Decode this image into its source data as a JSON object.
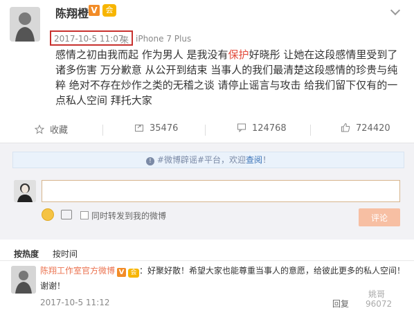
{
  "post": {
    "author": "陈翔橙",
    "badge_v": "V",
    "badge_member": "会",
    "date": "2017-10-5 11:07",
    "source_prefix": "来",
    "device": "iPhone 7 Plus",
    "content_parts": [
      "感情之初由我而起 作为男人 是我没有",
      "保护",
      "好晓彤 让她在这段感情里受到了诸多伤害 万分歉意 从公开到结束 当事人的我们最清楚这段感情的珍贵与纯粹 绝对不存在炒作之类的无稽之谈 请停止谣言与攻击 给我们留下仅有的一点私人空间 拜托大家"
    ]
  },
  "actions": {
    "favorite": "收藏",
    "share_count": "35476",
    "comment_count": "124768",
    "like_count": "724420"
  },
  "comment_box": {
    "notice_prefix": "#微博辟谣#平台，欢迎",
    "notice_link": "查阅",
    "notice_suffix": "！",
    "input_value": "",
    "also_forward_label": "同时转发到我的微博",
    "submit_label": "评论"
  },
  "sort_tabs": {
    "hot": "按热度",
    "time": "按时间"
  },
  "comment": {
    "author": "陈翔工作室官方微博",
    "badge_v": "V",
    "badge_member": "会",
    "text": "：好聚好散！希望大家也能尊重当事人的意愿，给彼此更多的私人空间！谢谢！",
    "date": "2017-10-5 11:12",
    "reply_label": "回复"
  },
  "watermark": {
    "top": "姚哥",
    "bottom": "96072"
  },
  "colors": {
    "accent": "#eb7350",
    "highlight": "#e24a3b",
    "time_box": "#c8312e",
    "submit_bg": "#f7bfa3"
  }
}
